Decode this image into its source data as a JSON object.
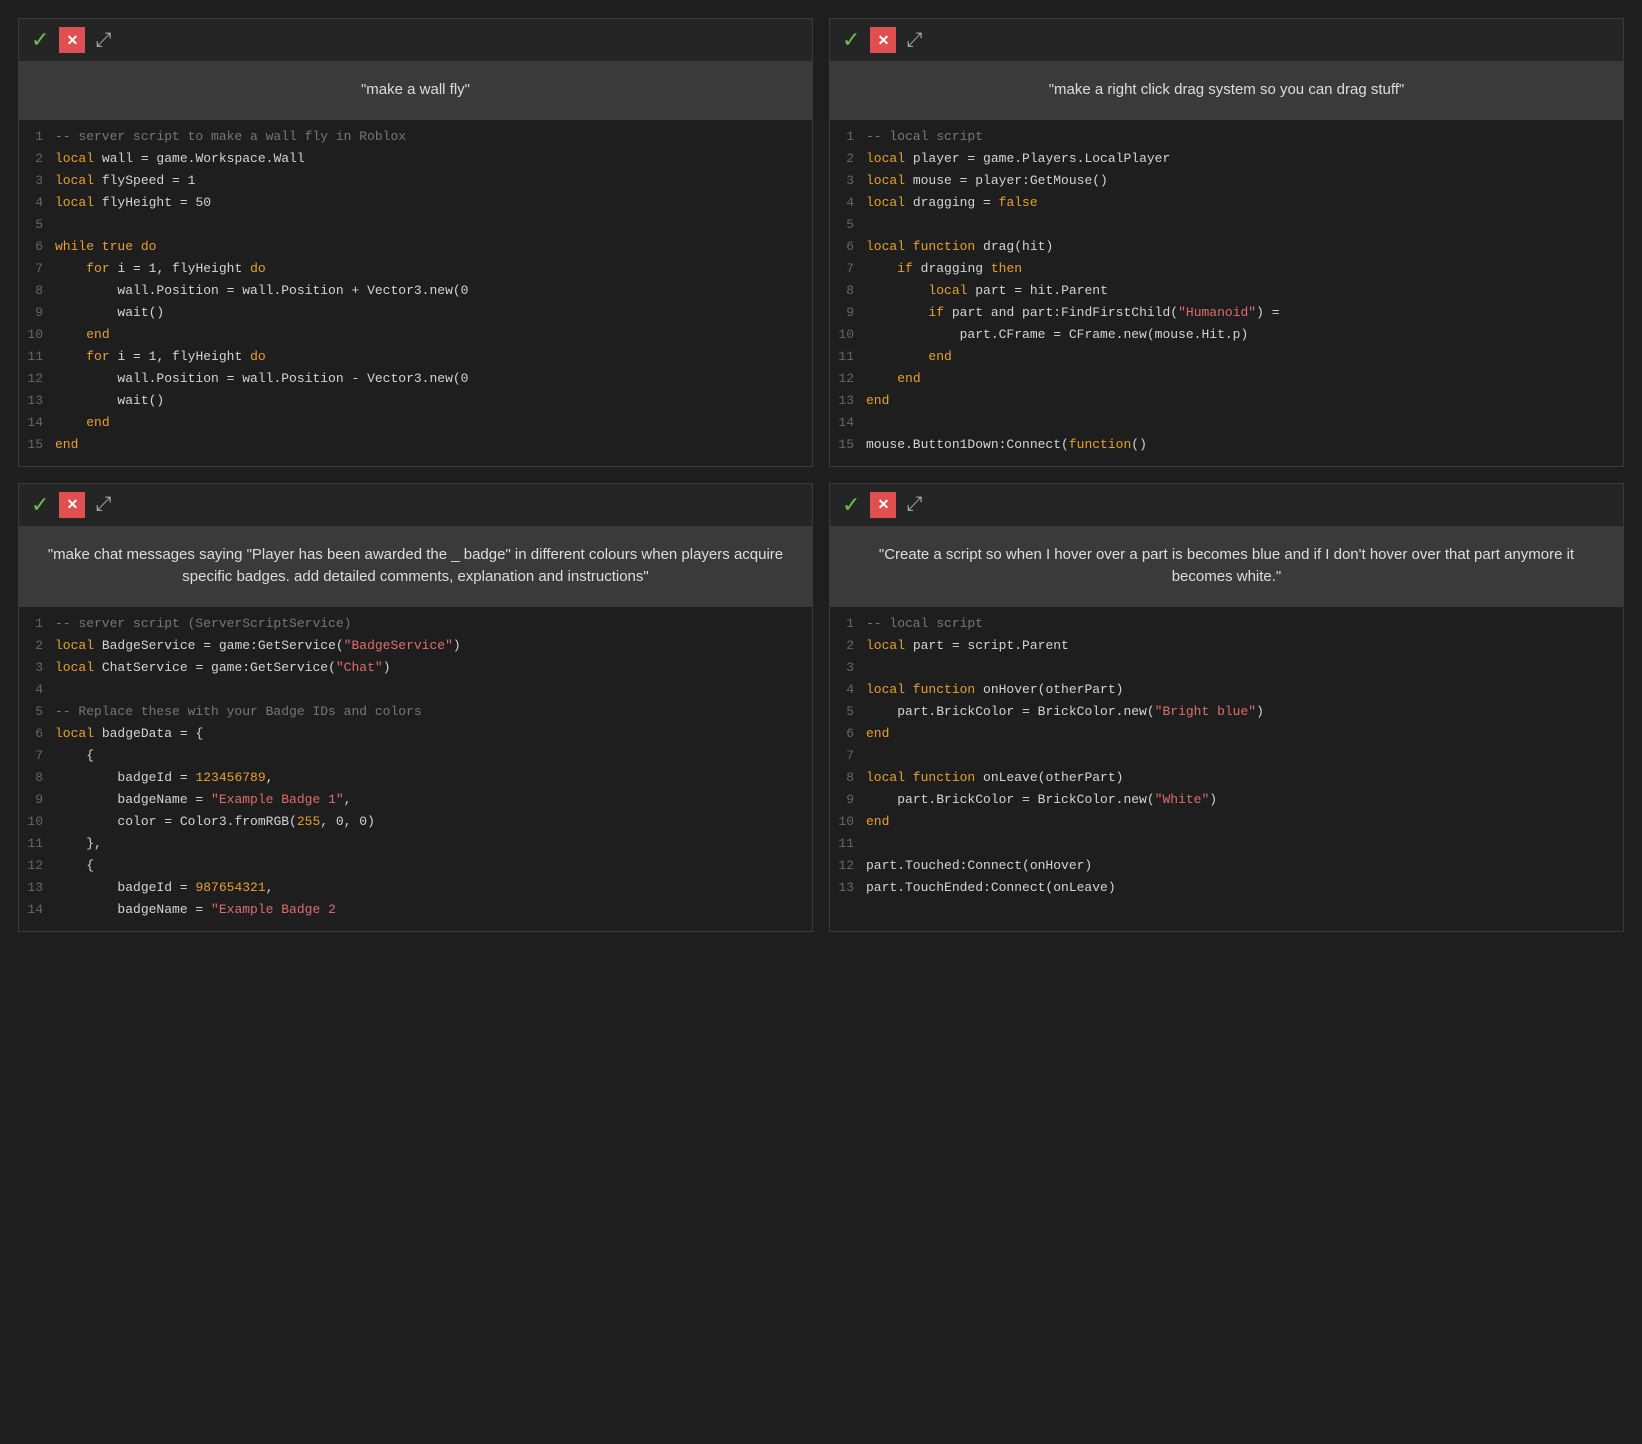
{
  "panels": [
    {
      "id": "panel-1",
      "prompt": "\"make a wall fly\"",
      "lines": [
        {
          "num": 1,
          "html": "<span class='cm'>-- server script to make a wall fly in Roblox</span>"
        },
        {
          "num": 2,
          "html": "<span class='kw'>local</span> <span class='plain'>wall = game.Workspace.Wall</span>"
        },
        {
          "num": 3,
          "html": "<span class='kw'>local</span> <span class='plain'>flySpeed = 1</span>"
        },
        {
          "num": 4,
          "html": "<span class='kw'>local</span> <span class='plain'>flyHeight = 50</span>"
        },
        {
          "num": 5,
          "html": ""
        },
        {
          "num": 6,
          "html": "<span class='kw'>while true do</span>"
        },
        {
          "num": 7,
          "html": "    <span class='kw'>for</span> <span class='plain'>i = 1, flyHeight</span> <span class='kw'>do</span>"
        },
        {
          "num": 8,
          "html": "        <span class='plain'>wall.Position = wall.Position + Vector3.new(0</span>"
        },
        {
          "num": 9,
          "html": "        <span class='plain'>wait()</span>"
        },
        {
          "num": 10,
          "html": "    <span class='kw'>end</span>"
        },
        {
          "num": 11,
          "html": "    <span class='kw'>for</span> <span class='plain'>i = 1, flyHeight</span> <span class='kw'>do</span>"
        },
        {
          "num": 12,
          "html": "        <span class='plain'>wall.Position = wall.Position - Vector3.new(0</span>"
        },
        {
          "num": 13,
          "html": "        <span class='plain'>wait()</span>"
        },
        {
          "num": 14,
          "html": "    <span class='kw'>end</span>"
        },
        {
          "num": 15,
          "html": "<span class='kw'>end</span>"
        }
      ]
    },
    {
      "id": "panel-2",
      "prompt": "\"make a right click drag system so you can drag stuff\"",
      "lines": [
        {
          "num": 1,
          "html": "<span class='cm'>-- local script</span>"
        },
        {
          "num": 2,
          "html": "<span class='kw'>local</span> <span class='plain'>player = game.Players.LocalPlayer</span>"
        },
        {
          "num": 3,
          "html": "<span class='kw'>local</span> <span class='plain'>mouse = player:GetMouse()</span>"
        },
        {
          "num": 4,
          "html": "<span class='kw'>local</span> <span class='plain'>dragging = </span><span class='kw'>false</span>"
        },
        {
          "num": 5,
          "html": ""
        },
        {
          "num": 6,
          "html": "<span class='kw'>local function</span> <span class='plain'>drag(hit)</span>"
        },
        {
          "num": 7,
          "html": "    <span class='kw'>if</span> <span class='plain'>dragging</span> <span class='kw'>then</span>"
        },
        {
          "num": 8,
          "html": "        <span class='kw'>local</span> <span class='plain'>part = hit.Parent</span>"
        },
        {
          "num": 9,
          "html": "        <span class='kw'>if</span> <span class='plain'>part and part:FindFirstChild(<span class='str'>\"Humanoid\"</span>) =</span>"
        },
        {
          "num": 10,
          "html": "            <span class='plain'>part.CFrame = CFrame.new(mouse.Hit.p)</span>"
        },
        {
          "num": 11,
          "html": "        <span class='kw'>end</span>"
        },
        {
          "num": 12,
          "html": "    <span class='kw'>end</span>"
        },
        {
          "num": 13,
          "html": "<span class='kw'>end</span>"
        },
        {
          "num": 14,
          "html": ""
        },
        {
          "num": 15,
          "html": "<span class='plain'>mouse.Button1Down:Connect(</span><span class='kw'>function</span><span class='plain'>()</span>"
        }
      ]
    },
    {
      "id": "panel-3",
      "prompt": "\"make chat messages saying \"Player has been awarded the _ badge\" in different colours when players acquire specific badges. add detailed comments, explanation and instructions\"",
      "lines": [
        {
          "num": 1,
          "html": "<span class='cm'>-- server script (ServerScriptService)</span>"
        },
        {
          "num": 2,
          "html": "<span class='kw'>local</span> <span class='plain'>BadgeService = game:GetService(<span class='str'>\"BadgeService\"</span>)</span>"
        },
        {
          "num": 3,
          "html": "<span class='kw'>local</span> <span class='plain'>ChatService = game:GetService(<span class='str'>\"Chat\"</span>)</span>"
        },
        {
          "num": 4,
          "html": ""
        },
        {
          "num": 5,
          "html": "<span class='cm'>-- Replace these with your Badge IDs and colors</span>"
        },
        {
          "num": 6,
          "html": "<span class='kw'>local</span> <span class='plain'>badgeData = {</span>"
        },
        {
          "num": 7,
          "html": "    <span class='plain'>{</span>"
        },
        {
          "num": 8,
          "html": "        <span class='plain'>badgeId = <span class='num'>123456789</span>,</span>"
        },
        {
          "num": 9,
          "html": "        <span class='plain'>badgeName = <span class='str'>\"Example Badge 1\"</span>,</span>"
        },
        {
          "num": 10,
          "html": "        <span class='plain'>color = Color3.fromRGB(<span class='num'>255</span>, 0, 0)</span>"
        },
        {
          "num": 11,
          "html": "    <span class='plain'>},</span>"
        },
        {
          "num": 12,
          "html": "    <span class='plain'>{</span>"
        },
        {
          "num": 13,
          "html": "        <span class='plain'>badgeId = <span class='num'>987654321</span>,</span>"
        },
        {
          "num": 14,
          "html": "        <span class='plain'>badgeName = <span class='str'>\"Example Badge 2</span>"
        }
      ]
    },
    {
      "id": "panel-4",
      "prompt": "\"Create a script so when I hover over a part is becomes blue and if I don't hover over that part anymore it becomes white.\"",
      "lines": [
        {
          "num": 1,
          "html": "<span class='cm'>-- local script</span>"
        },
        {
          "num": 2,
          "html": "<span class='kw'>local</span> <span class='plain'>part = script.Parent</span>"
        },
        {
          "num": 3,
          "html": ""
        },
        {
          "num": 4,
          "html": "<span class='kw'>local function</span> <span class='plain'>onHover(otherPart)</span>"
        },
        {
          "num": 5,
          "html": "    <span class='plain'>part.BrickColor = BrickColor.new(<span class='str'>\"Bright blue\"</span>)</span>"
        },
        {
          "num": 6,
          "html": "<span class='kw'>end</span>"
        },
        {
          "num": 7,
          "html": ""
        },
        {
          "num": 8,
          "html": "<span class='kw'>local function</span> <span class='plain'>onLeave(otherPart)</span>"
        },
        {
          "num": 9,
          "html": "    <span class='plain'>part.BrickColor = BrickColor.new(<span class='str'>\"White\"</span>)</span>"
        },
        {
          "num": 10,
          "html": "<span class='kw'>end</span>"
        },
        {
          "num": 11,
          "html": ""
        },
        {
          "num": 12,
          "html": "<span class='plain'>part.Touched:Connect(onHover)</span>"
        },
        {
          "num": 13,
          "html": "<span class='plain'>part.TouchEnded:Connect(onLeave)</span>"
        }
      ]
    }
  ],
  "toolbar": {
    "check_symbol": "✓",
    "close_label": "✕",
    "expand_symbol": "⤢"
  }
}
